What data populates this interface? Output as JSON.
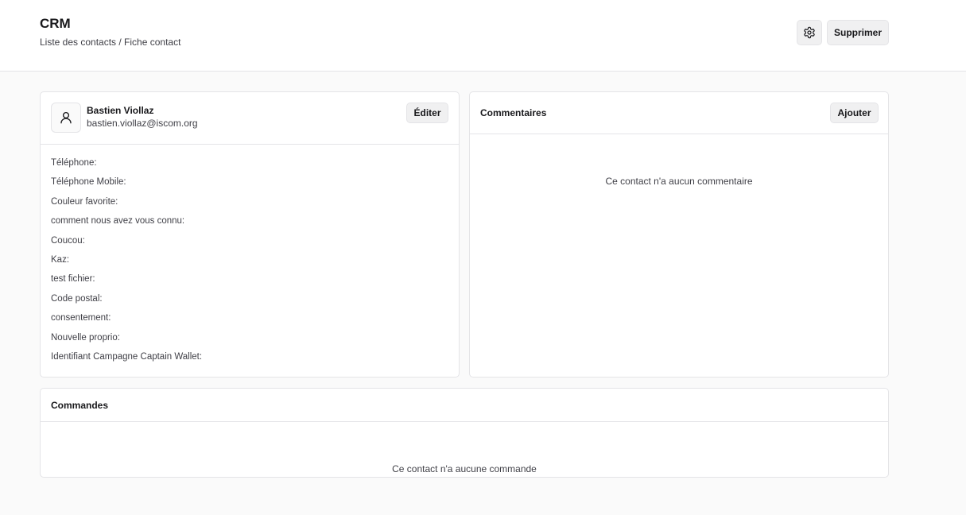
{
  "header": {
    "title": "CRM",
    "breadcrumb": "Liste des contacts / Fiche contact",
    "settings_icon": "gear-icon",
    "delete_label": "Supprimer"
  },
  "contact": {
    "avatar_icon": "user-icon",
    "name": "Bastien Viollaz",
    "email": "bastien.viollaz@iscom.org",
    "edit_label": "Éditer",
    "fields": [
      "Téléphone:",
      "Téléphone Mobile:",
      "Couleur favorite:",
      "comment nous avez vous connu:",
      "Coucou:",
      "Kaz:",
      "test fichier:",
      "Code postal:",
      "consentement:",
      "Nouvelle proprio:",
      "Identifiant Campagne Captain Wallet:"
    ]
  },
  "comments": {
    "title": "Commentaires",
    "add_label": "Ajouter",
    "empty_text": "Ce contact n'a aucun commentaire"
  },
  "orders": {
    "title": "Commandes",
    "empty_text": "Ce contact n'a aucune commande"
  }
}
